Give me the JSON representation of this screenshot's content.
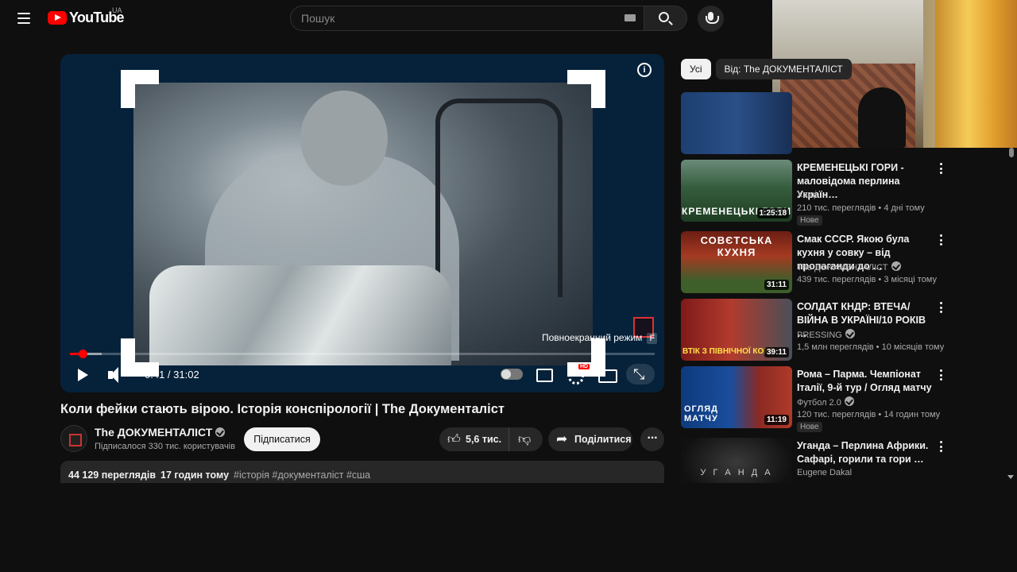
{
  "topbar": {
    "logo_text": "YouTube",
    "country_code": "UA",
    "search_placeholder": "Пошук"
  },
  "player": {
    "time_current": "0:41",
    "time_total": "31:02",
    "time_display": "0:41 / 31:02",
    "progress_fraction": 0.022,
    "buffered_fraction": 0.055,
    "fullscreen_tooltip": "Повноекранний режим",
    "fullscreen_shortcut": "F",
    "hd_badge": "HD",
    "info_glyph": "i"
  },
  "video": {
    "title": "Коли фейки стають вірою. Історія конспірології | The Документаліст",
    "channel": {
      "name": "The ДОКУМЕНТАЛІСТ",
      "subscribers": "Підписалося 330 тис. користувачів"
    },
    "subscribe_label": "Підписатися",
    "likes": "5,6 тис.",
    "share_label": "Поділитися",
    "views": "44 129 переглядів",
    "published": "17 годин тому",
    "tags": "#історія #документаліст #сша"
  },
  "chips": [
    {
      "label": "Усі",
      "active": true
    },
    {
      "label": "Від: The ДОКУМЕНТАЛІСТ",
      "active": false
    }
  ],
  "recommendations": [
    {
      "title": "КРЕМЕНЕЦЬКІ ГОРИ - маловідома перлина Україн…",
      "channel": "Хащі",
      "verified": false,
      "meta": "210 тис. переглядів • 4 дні тому",
      "badge": "Нове",
      "duration": "1:25:18",
      "thumb_caption": "КРЕМЕНЕЦЬКІ ГОРИ"
    },
    {
      "title": "Смак СССР. Якою була кухня у совку – від пропаганди до …",
      "channel": "The ДОКУМЕНТАЛІСТ",
      "verified": true,
      "meta": "439 тис. переглядів • 3 місяці тому",
      "badge": "",
      "duration": "31:11",
      "thumb_caption": "СОВЄТСЬКА КУХНЯ"
    },
    {
      "title": "СОЛДАТ КНДР: ВТЕЧА/ВІЙНА В УКРАЇНІ/10 РОКІВ …",
      "channel": "PRESSING",
      "verified": true,
      "meta": "1,5 млн переглядів • 10 місяців тому",
      "badge": "",
      "duration": "39:11",
      "thumb_caption": "ВТІК З ПІВНІЧНОЇ КОРЕ"
    },
    {
      "title": "Рома – Парма. Чемпіонат Італії, 9-й тур / Огляд матчу",
      "channel": "Футбол 2.0",
      "verified": true,
      "meta": "120 тис. переглядів • 14 годин тому",
      "badge": "Нове",
      "duration": "11:19",
      "thumb_caption": "ОГЛЯД МАТЧУ"
    },
    {
      "title": "Уганда – Перлина Африки. Сафарі, горили та гори …",
      "channel": "Eugene Dakal",
      "verified": false,
      "meta": "",
      "badge": "",
      "duration": "",
      "thumb_caption": "У Г А Н Д А"
    }
  ],
  "colors": {
    "background": "#0f0f0f",
    "accent_red": "#ff0000",
    "text_primary": "#f1f1f1",
    "text_secondary": "#aaaaaa"
  }
}
